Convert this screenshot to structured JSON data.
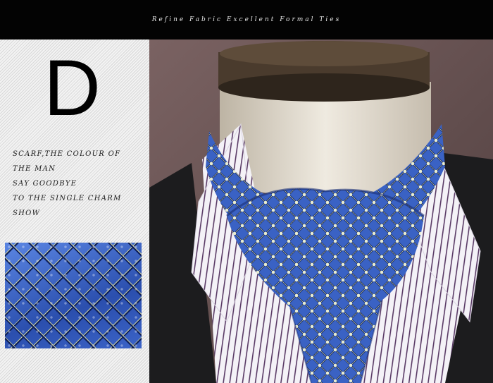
{
  "banner": {
    "text": "Refine Fabric Excellent Formal Ties"
  },
  "product": {
    "letter": "D",
    "tagline": [
      "SCARF,THE COLOUR OF",
      "THE MAN",
      "SAY GOODBYE",
      "TO THE SINGLE CHARM",
      "SHOW"
    ]
  },
  "colors": {
    "banner_background": "#030303",
    "scarf_blue": "#3a62c4",
    "pattern_navy": "#0d1f5a",
    "backdrop": "#6b5656",
    "jacket": "#1c1c1e",
    "shirt_stripe": "#5a3b66"
  }
}
